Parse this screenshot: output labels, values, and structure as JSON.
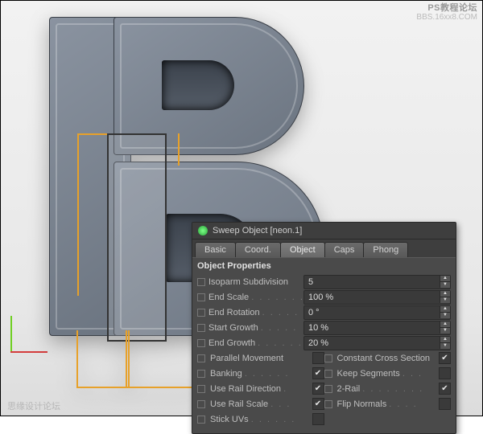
{
  "watermark_top": {
    "line1": "PS教程论坛",
    "line2": "BBS.16xx8.COM"
  },
  "watermark_bottom": "思缘设计论坛",
  "panel": {
    "title": "Sweep Object [neon.1]",
    "tabs": {
      "basic": "Basic",
      "coord": "Coord.",
      "object": "Object",
      "caps": "Caps",
      "phong": "Phong"
    },
    "section": "Object Properties",
    "fields": {
      "isoparm": {
        "label": "Isoparm Subdivision",
        "value": "5"
      },
      "endscale": {
        "label": "End Scale",
        "value": "100 %"
      },
      "endrot": {
        "label": "End Rotation",
        "value": "0 °"
      },
      "startg": {
        "label": "Start Growth",
        "value": "10 %"
      },
      "endg": {
        "label": "End Growth",
        "value": "20 %"
      }
    },
    "checks": {
      "parallel": {
        "label": "Parallel Movement",
        "checked": false
      },
      "constant": {
        "label": "Constant Cross Section",
        "checked": true
      },
      "banking": {
        "label": "Banking",
        "checked": true
      },
      "keepseg": {
        "label": "Keep Segments",
        "checked": false
      },
      "raildir": {
        "label": "Use Rail Direction",
        "checked": true
      },
      "tworail": {
        "label": "2-Rail",
        "checked": true
      },
      "railscl": {
        "label": "Use Rail Scale",
        "checked": true
      },
      "flipn": {
        "label": "Flip Normals",
        "checked": false
      },
      "stick": {
        "label": "Stick UVs",
        "checked": false
      }
    }
  }
}
